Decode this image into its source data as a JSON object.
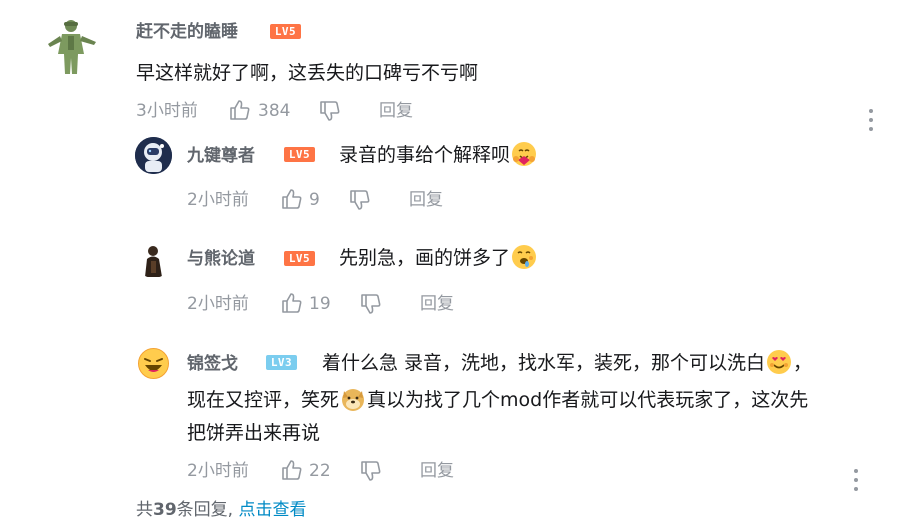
{
  "comment": {
    "user": "赶不走的瞌睡",
    "level": "LV5",
    "text": "早这样就好了啊，这丢失的口碑亏不亏啊",
    "time": "3小时前",
    "likes": "384",
    "reply_label": "回复"
  },
  "replies": [
    {
      "user": "九键尊者",
      "level": "LV5",
      "text": "录音的事给个解释呗",
      "time": "2小时前",
      "likes": "9",
      "reply_label": "回复"
    },
    {
      "user": "与熊论道",
      "level": "LV5",
      "text": "先别急，画的饼多了",
      "time": "2小时前",
      "likes": "19",
      "reply_label": "回复"
    },
    {
      "user": "锦签戈",
      "level": "LV3",
      "line1": "着什么急 录音，洗地，找水军，装死，那个可以洗白",
      "line1_tail": "，",
      "line2_a": "现在又控评，笑死",
      "line2_b": "真以为找了几个mod作者就可以代表玩家了，这次先",
      "line3": "把饼弄出来再说",
      "time": "2小时前",
      "likes": "22",
      "reply_label": "回复"
    }
  ],
  "footer": {
    "prefix": "共",
    "count": "39",
    "suffix": "条回复,",
    "view_link": "点击查看"
  },
  "colors": {
    "username": "#61666d",
    "text": "#18191c",
    "meta": "#9499a0",
    "lv5": "#fe7445",
    "lv3": "#7bcdef",
    "link": "#008ac5"
  }
}
